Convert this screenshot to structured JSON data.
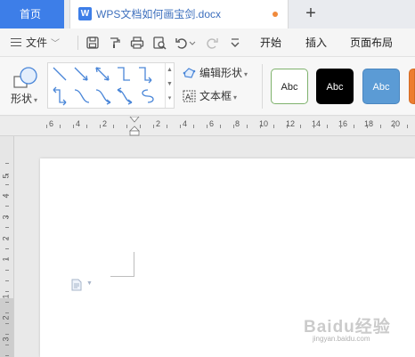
{
  "tabs": {
    "home_label": "首页",
    "doc_icon_letter": "W",
    "doc_title": "WPS文档如何画宝剑.docx",
    "add_symbol": "+"
  },
  "menubar": {
    "file_label": "文件",
    "file_caret": "﹀",
    "tabs": [
      "开始",
      "插入",
      "页面布局"
    ]
  },
  "ribbon": {
    "shape_label": "形状",
    "shape_caret": "▾",
    "edit_shape_label": "编辑形状",
    "text_box_label": "文本框",
    "dropdown_caret": "▾",
    "styles": [
      {
        "label": "Abc",
        "bg": "#ffffff",
        "border": "#7fb26d",
        "color": "#222222"
      },
      {
        "label": "Abc",
        "bg": "#000000",
        "border": "#000000",
        "color": "#ffffff"
      },
      {
        "label": "Abc",
        "bg": "#5b9bd5",
        "border": "#4a86c0",
        "color": "#ffffff"
      },
      {
        "label": "",
        "bg": "#ed7d31",
        "border": "#d46c24",
        "color": "#ffffff"
      }
    ]
  },
  "ruler": {
    "h_numbers": [
      "6",
      "4",
      "2",
      "2",
      "4",
      "6",
      "8",
      "10",
      "12",
      "14",
      "16",
      "18",
      "20",
      "22"
    ],
    "v_numbers": [
      "5",
      "4",
      "3",
      "2",
      "1",
      "1",
      "2",
      "3"
    ]
  },
  "watermark": {
    "main": "Baidu经验",
    "sub": "jingyan.baidu.com"
  },
  "colors": {
    "accent": "#3d7ee8",
    "unsaved_dot": "#f08a3c"
  }
}
